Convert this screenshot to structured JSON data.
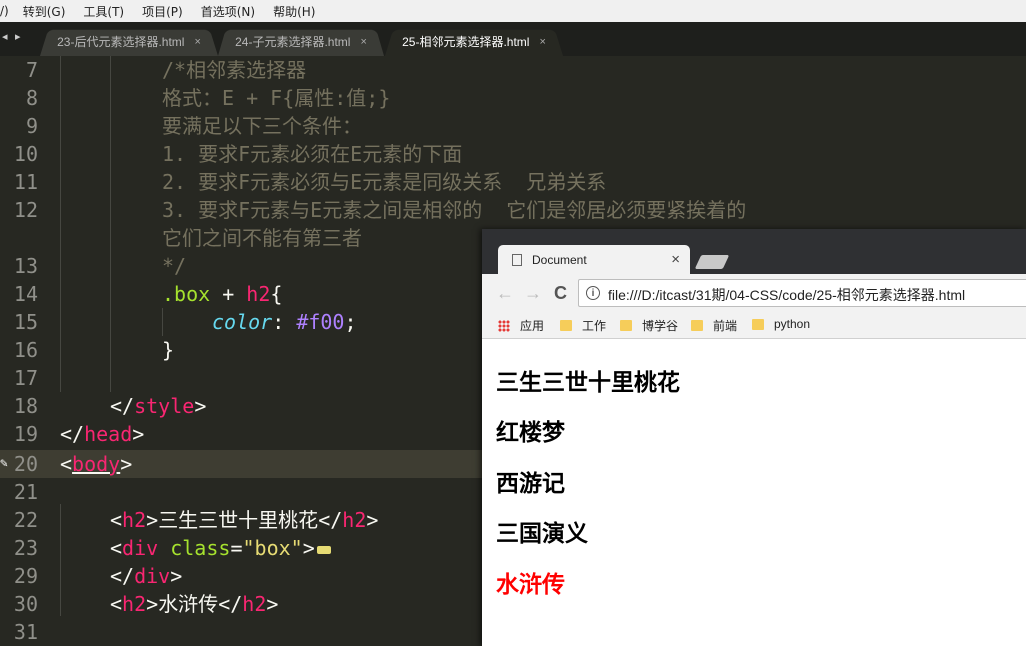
{
  "menu": [
    "/)",
    "转到(G)",
    "工具(T)",
    "项目(P)",
    "首选项(N)",
    "帮助(H)"
  ],
  "tabs": [
    {
      "label": "23-后代元素选择器.html",
      "close": "×"
    },
    {
      "label": "24-子元素选择器.html",
      "close": "×"
    },
    {
      "label": "25-相邻元素选择器.html",
      "close": "×"
    }
  ],
  "tab_nav": "◂ ▸",
  "editor": {
    "line_numbers": [
      "7",
      "8",
      "9",
      "10",
      "11",
      "12",
      "13",
      "14",
      "15",
      "16",
      "17",
      "18",
      "19",
      "20",
      "21",
      "22",
      "23",
      "29",
      "30",
      "31"
    ],
    "comment": [
      "/*相邻素选择器",
      "格式：E + F{属性:值;}",
      "要满足以下三个条件：",
      "1. 要求F元素必须在E元素的下面",
      "2. 要求F元素必须与E元素是同级关系  兄弟关系",
      "3. 要求F元素与E元素之间是相邻的  它们是邻居必须要紧挨着的",
      "它们之间不能有第三者",
      "*/"
    ],
    "selector": ".box",
    "plus": " + ",
    "h2": "h2",
    "brace_open": "{",
    "brace_close": "}",
    "prop": "color",
    "colon": ": ",
    "value": "#f00",
    "semicolon": ";",
    "lt": "<",
    "gt": ">",
    "lt_slash": "</",
    "style": "style",
    "head": "head",
    "body": "body",
    "div": "div",
    "class_attr": "class",
    "eq": "=",
    "box_str": "\"box\"",
    "h2_text_1": "三生三世十里桃花",
    "h2_text_2": "水浒传"
  },
  "browser": {
    "tab_title": "Document",
    "tab_close": "×",
    "back": "←",
    "forward": "→",
    "reload": "C",
    "url": "file:///D:/itcast/31期/04-CSS/code/25-相邻元素选择器.html",
    "bookmarks": [
      "应用",
      "工作",
      "博学谷",
      "前端",
      "python"
    ],
    "headings": [
      "三生三世十里桃花",
      "红楼梦",
      "西游记",
      "三国演义",
      "水浒传"
    ],
    "colors": {
      "highlight": "#ff0000"
    }
  }
}
